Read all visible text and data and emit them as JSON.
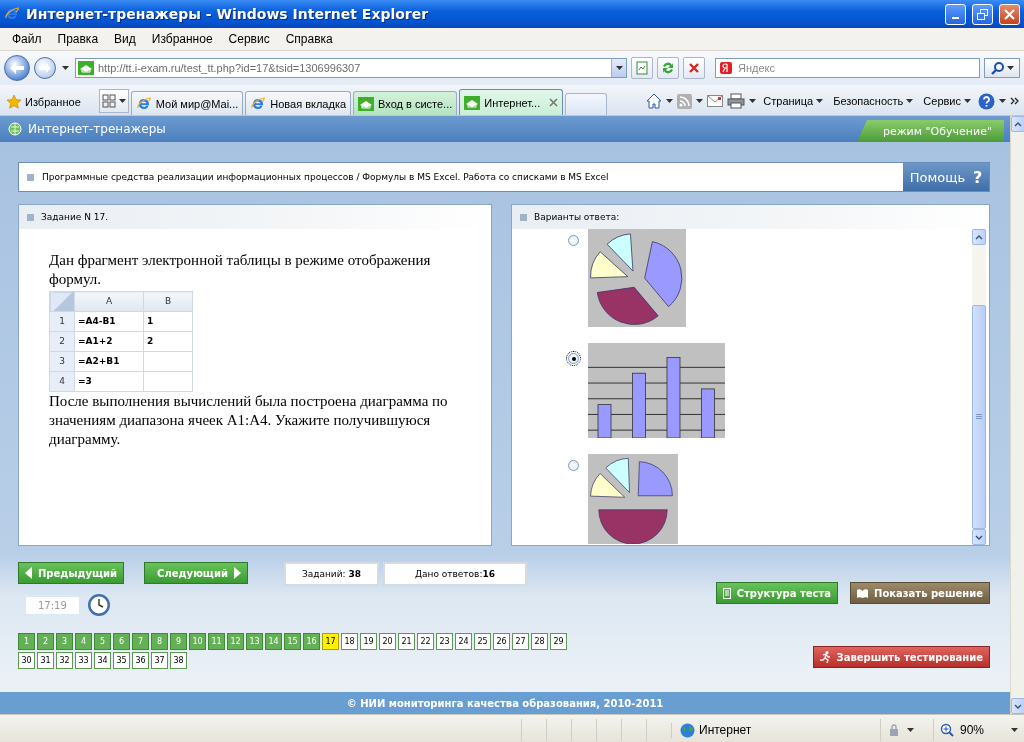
{
  "window": {
    "title": "Интернет-тренажеры - Windows Internet Explorer"
  },
  "menu": [
    "Файл",
    "Правка",
    "Вид",
    "Избранное",
    "Сервис",
    "Справка"
  ],
  "address": {
    "url": "http://tt.i-exam.ru/test_tt.php?id=17&tsid=1306996307"
  },
  "search": {
    "placeholder": "Яндекс"
  },
  "favorites": {
    "label": "Избранное"
  },
  "tabs": [
    {
      "label": "Мой мир@Mai...",
      "kind": "ie",
      "selected": false
    },
    {
      "label": "Новая вкладка",
      "kind": "ie",
      "selected": false
    },
    {
      "label": "Вход в систе...",
      "kind": "site",
      "selected": false
    },
    {
      "label": "Интернет...",
      "kind": "site",
      "selected": true
    }
  ],
  "toolbar_menus": [
    "Страница",
    "Безопасность",
    "Сервис"
  ],
  "page": {
    "title": "Интернет-тренажеры",
    "mode": "режим \"Обучение\""
  },
  "breadcrumb": "Программные средства реализации информационных процессов / Формулы в MS Excel. Работа со списками в MS Excel",
  "help": {
    "label": "Помощь",
    "mark": "?"
  },
  "task": {
    "header": "Задание N 17.",
    "intro": "Дан фрагмент электронной таблицы в режиме отображения формул.",
    "sheet": {
      "columns": [
        "A",
        "B"
      ],
      "rows": [
        {
          "row": "1",
          "a": "=A4-B1",
          "b": "1"
        },
        {
          "row": "2",
          "a": "=A1+2",
          "b": "2"
        },
        {
          "row": "3",
          "a": "=A2+B1"
        },
        {
          "row": "4",
          "a": "=3"
        }
      ]
    },
    "question": "После выполнения вычислений была построена диаграмма по значениям диапазона ячеек A1:A4. Укажите получившуюся диаграмму."
  },
  "answers": {
    "header": "Варианты ответа:",
    "options": [
      {
        "kind": "pie",
        "selected": false
      },
      {
        "kind": "bars",
        "selected": true
      },
      {
        "kind": "halfpie",
        "selected": false
      }
    ]
  },
  "nav": {
    "prev": "Предыдущий",
    "next": "Следующий",
    "tasks": "Заданий: **38**",
    "answered": "Дано ответов:**16**",
    "time": "17:19",
    "structure": "Структура теста",
    "solution": "Показать решение",
    "finish": "Завершить тестирование"
  },
  "questions": [
    {
      "label": "1",
      "answered": true,
      "selected": false
    },
    {
      "label": "2",
      "answered": true,
      "selected": false
    },
    {
      "label": "3",
      "answered": true,
      "selected": false
    },
    {
      "label": "4",
      "answered": true,
      "selected": false
    },
    {
      "label": "5",
      "answered": true,
      "selected": false
    },
    {
      "label": "6",
      "answered": true,
      "selected": false
    },
    {
      "label": "7",
      "answered": true,
      "selected": false
    },
    {
      "label": "8",
      "answered": true,
      "selected": false
    },
    {
      "label": "9",
      "answered": true,
      "selected": false
    },
    {
      "label": "10",
      "answered": true,
      "selected": false
    },
    {
      "label": "11",
      "answered": true,
      "selected": false
    },
    {
      "label": "12",
      "answered": true,
      "selected": false
    },
    {
      "label": "13",
      "answered": true,
      "selected": false
    },
    {
      "label": "14",
      "answered": true,
      "selected": false
    },
    {
      "label": "15",
      "answered": true,
      "selected": false
    },
    {
      "label": "16",
      "answered": true,
      "selected": false
    },
    {
      "label": "17",
      "answered": false,
      "selected": true
    },
    {
      "label": "18",
      "answered": false,
      "selected": false
    },
    {
      "label": "19",
      "answered": false,
      "selected": false
    },
    {
      "label": "20",
      "answered": false,
      "selected": false
    },
    {
      "label": "21",
      "answered": false,
      "selected": false
    },
    {
      "label": "22",
      "answered": false,
      "selected": false
    },
    {
      "label": "23",
      "answered": false,
      "selected": false
    },
    {
      "label": "24",
      "answered": false,
      "selected": false
    },
    {
      "label": "25",
      "answered": false,
      "selected": false
    },
    {
      "label": "26",
      "answered": false,
      "selected": false
    },
    {
      "label": "27",
      "answered": false,
      "selected": false
    },
    {
      "label": "28",
      "answered": false,
      "selected": false
    },
    {
      "label": "29",
      "answered": false,
      "selected": false
    },
    {
      "label": "30",
      "answered": false,
      "selected": false
    },
    {
      "label": "31",
      "answered": false,
      "selected": false
    },
    {
      "label": "32",
      "answered": false,
      "selected": false
    },
    {
      "label": "33",
      "answered": false,
      "selected": false
    },
    {
      "label": "34",
      "answered": false,
      "selected": false
    },
    {
      "label": "35",
      "answered": false,
      "selected": false
    },
    {
      "label": "36",
      "answered": false,
      "selected": false
    },
    {
      "label": "37",
      "answered": false,
      "selected": false
    },
    {
      "label": "38",
      "answered": false,
      "selected": false
    }
  ],
  "footer": "© НИИ мониторинга качества образования, 2010-2011",
  "status": {
    "zone": "Интернет",
    "zoom": "90%"
  }
}
